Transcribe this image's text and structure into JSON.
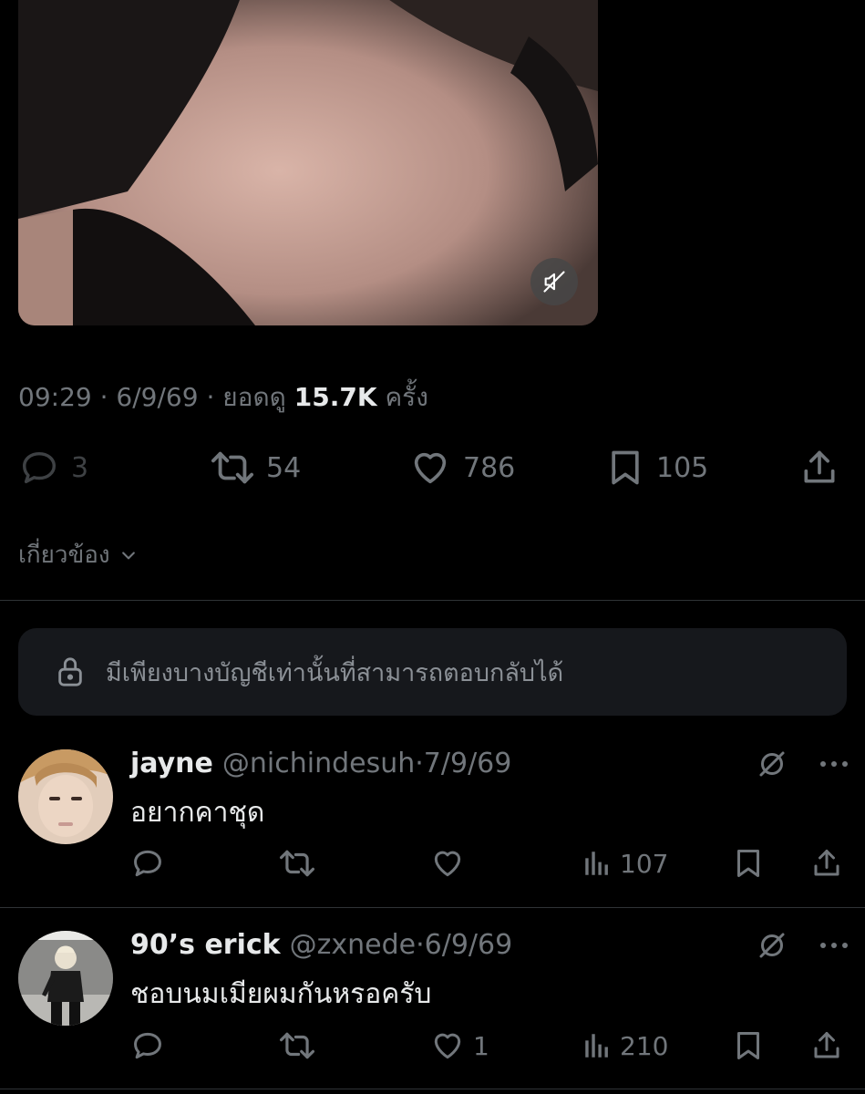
{
  "tweet": {
    "time": "09:29",
    "date": "6/9/69",
    "views_prefix": "ยอดดู",
    "views_count": "15.7K",
    "views_suffix": "ครั้ง",
    "replies": "3",
    "retweets": "54",
    "likes": "786",
    "bookmarks": "105"
  },
  "related_label": "เกี่ยวข้อง",
  "reply_notice": "มีเพียงบางบัญชีเท่านั้นที่สามารถตอบกลับได้",
  "replies": [
    {
      "name": "jayne",
      "handle": "@nichindesuh",
      "date": "7/9/69",
      "text": "อยากคาชุด",
      "likes": "",
      "views": "107"
    },
    {
      "name": "90’s erick",
      "handle": "@zxnede",
      "date": "6/9/69",
      "text": "ชอบนมเมียผมกันหรอครับ",
      "likes": "1",
      "views": "210"
    }
  ],
  "icons": {
    "mute": "speaker-muted-icon",
    "reply": "speech-bubble-icon",
    "retweet": "retweet-icon",
    "like": "heart-icon",
    "bookmark": "bookmark-icon",
    "share": "share-icon",
    "views": "bar-chart-icon",
    "grok": "slash-circle-icon",
    "more": "more-dots-icon",
    "lock": "lock-icon",
    "chevron": "chevron-down-icon"
  }
}
